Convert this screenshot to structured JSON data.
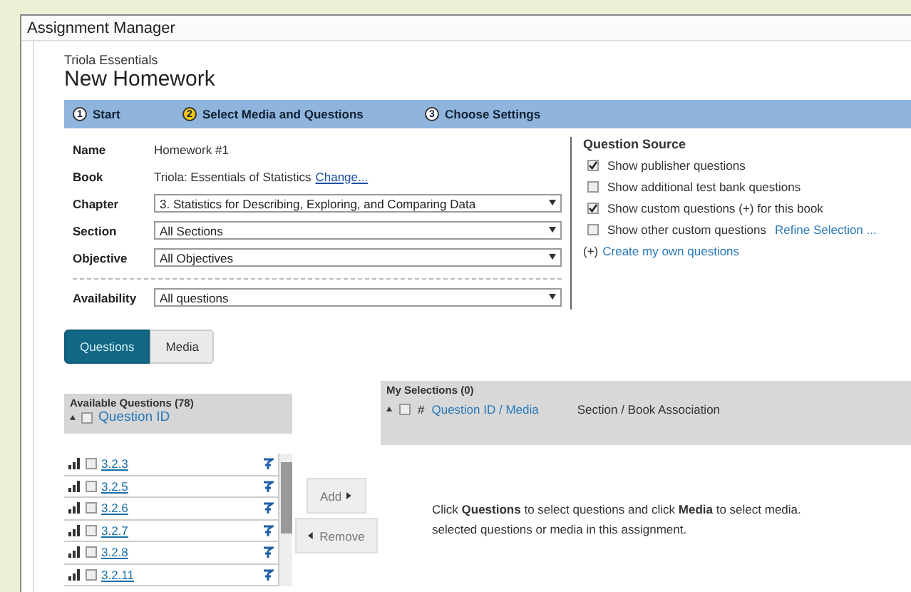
{
  "window": {
    "title": "Assignment Manager"
  },
  "header": {
    "course": "Triola Essentials",
    "title": "New Homework"
  },
  "steps": [
    {
      "number": "1",
      "label": "Start",
      "selected": false
    },
    {
      "number": "2",
      "label": "Select Media and Questions",
      "selected": true
    },
    {
      "number": "3",
      "label": "Choose Settings",
      "selected": false
    }
  ],
  "form": [
    {
      "kind": "text",
      "label": "Name",
      "value": "Homework #1"
    },
    {
      "kind": "link",
      "label": "Book",
      "value": "Triola: Essentials of Statistics",
      "link": "Change..."
    },
    {
      "kind": "select",
      "label": "Chapter",
      "value": "3. Statistics for Describing, Exploring, and Comparing Data"
    },
    {
      "kind": "select",
      "label": "Section",
      "value": "All Sections"
    },
    {
      "kind": "select",
      "label": "Objective",
      "value": "All Objectives"
    },
    {
      "kind": "select",
      "label": "Availability",
      "value": "All questions",
      "separated": true
    }
  ],
  "question_source": {
    "title": "Question Source",
    "options": [
      {
        "label": "Show publisher questions",
        "checked": true
      },
      {
        "label": "Show additional test bank questions",
        "checked": false
      },
      {
        "label": "Show custom questions (+) for this book",
        "checked": true
      },
      {
        "label": "Show other custom questions",
        "checked": false,
        "link": "Refine Selection ..."
      }
    ],
    "create": {
      "prefix": "(+)",
      "link": "Create my own questions"
    }
  },
  "tabs": [
    {
      "label": "Questions",
      "selected": true
    },
    {
      "label": "Media",
      "selected": false
    }
  ],
  "available": {
    "title": "Available Questions",
    "count": "(78)",
    "column": "Question ID",
    "all_checked": false,
    "rows": [
      {
        "id": "3.2.3",
        "checked": false
      },
      {
        "id": "3.2.5",
        "checked": false
      },
      {
        "id": "3.2.6",
        "checked": false
      },
      {
        "id": "3.2.7",
        "checked": false
      },
      {
        "id": "3.2.8",
        "checked": false
      },
      {
        "id": "3.2.11",
        "checked": false
      }
    ]
  },
  "buttons": {
    "add": "Add",
    "remove": "Remove"
  },
  "selections": {
    "title": "My Selections (0)",
    "all_checked": false,
    "columns": [
      "#",
      "Question ID / Media",
      "Section / Book Association"
    ],
    "message": [
      "Click **Questions** to select questions and click **Media** to select media.",
      "selected questions or media in this assignment."
    ]
  }
}
